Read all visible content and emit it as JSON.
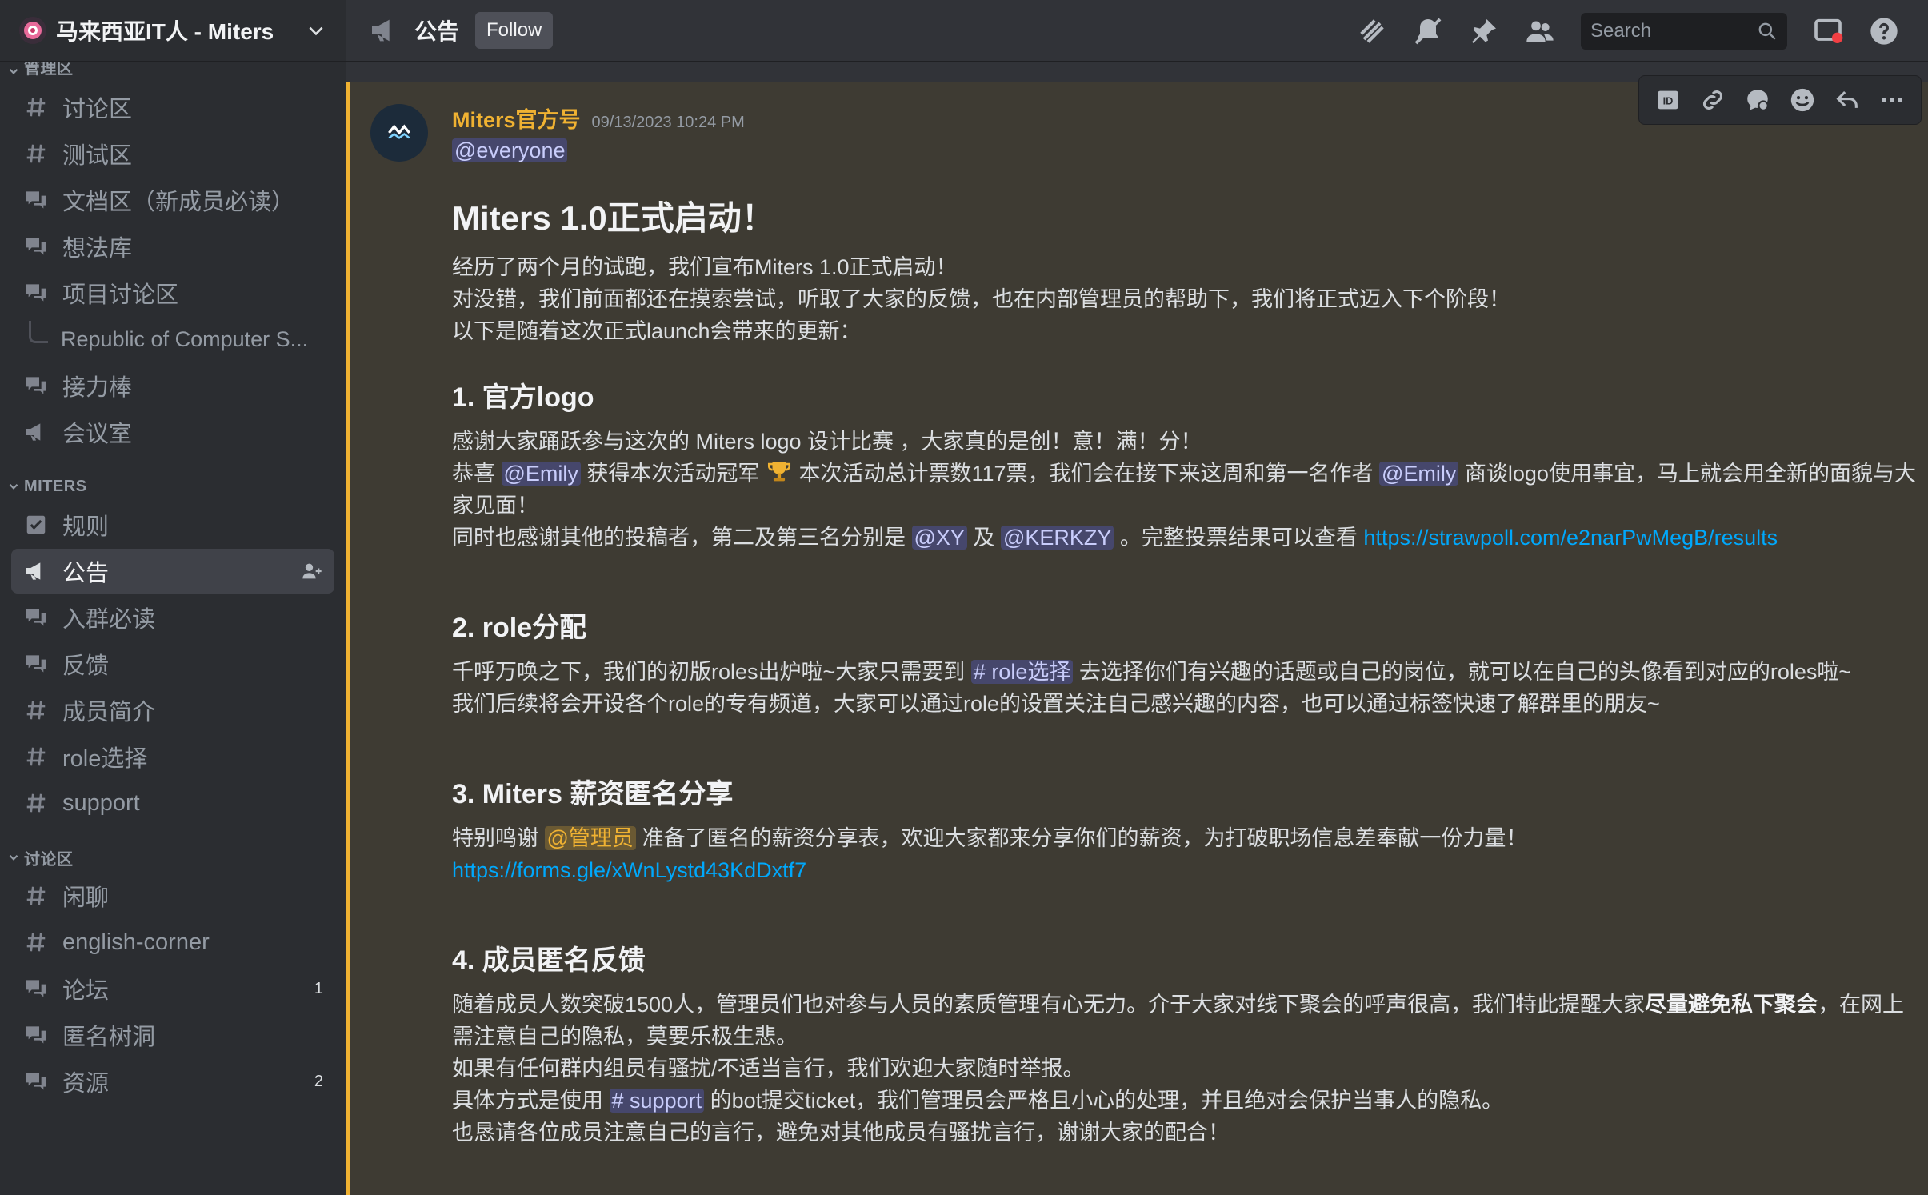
{
  "server": {
    "name": "马来西亚IT人 - Miters"
  },
  "sidebar": {
    "partial_category": "管理区",
    "top_channels": [
      {
        "icon": "hash-icon",
        "label": "讨论区"
      },
      {
        "icon": "hash-icon",
        "label": "测试区"
      },
      {
        "icon": "forum-icon",
        "label": "文档区（新成员必读）"
      },
      {
        "icon": "forum-icon",
        "label": "想法库"
      },
      {
        "icon": "forum-icon",
        "label": "项目讨论区"
      }
    ],
    "thread": {
      "label": "Republic of Computer S..."
    },
    "top_channels_2": [
      {
        "icon": "forum-icon",
        "label": "接力棒"
      },
      {
        "icon": "announce-icon",
        "label": "会议室"
      }
    ],
    "category_miters": "MITERS",
    "miters_channels": [
      {
        "icon": "rules-icon",
        "label": "规则"
      },
      {
        "icon": "announce-icon",
        "label": "公告",
        "active": true
      },
      {
        "icon": "forum-icon",
        "label": "入群必读"
      },
      {
        "icon": "forum-icon",
        "label": "反馈"
      },
      {
        "icon": "hash-icon",
        "label": "成员简介"
      },
      {
        "icon": "hash-icon",
        "label": "role选择"
      },
      {
        "icon": "hash-icon",
        "label": "support"
      }
    ],
    "category_discuss": "讨论区",
    "discuss_channels": [
      {
        "icon": "hash-icon",
        "label": "闲聊"
      },
      {
        "icon": "hash-icon",
        "label": "english-corner"
      },
      {
        "icon": "forum-icon",
        "label": "论坛",
        "badge": "1"
      },
      {
        "icon": "forum-icon",
        "label": "匿名树洞"
      },
      {
        "icon": "forum-icon",
        "label": "资源",
        "badge": "2"
      }
    ]
  },
  "topbar": {
    "channel_name": "公告",
    "follow_label": "Follow",
    "search_placeholder": "Search"
  },
  "message": {
    "author": "Miters官方号",
    "timestamp": "09/13/2023 10:24 PM",
    "mention_everyone": "@everyone",
    "title": "Miters 1.0正式启动！",
    "intro": [
      "经历了两个月的试跑，我们宣布Miters 1.0正式启动！",
      "对没错，我们前面都还在摸索尝试，听取了大家的反馈，也在内部管理员的帮助下，我们将正式迈入下个阶段！",
      "以下是随着这次正式launch会带来的更新："
    ],
    "s1": {
      "heading": "1. 官方logo",
      "line1": "感谢大家踊跃参与这次的 Miters logo 设计比赛 ，大家真的是创！意！满！分！",
      "l2a": "恭喜 ",
      "l2_mention1": "@Emily",
      "l2b": " 获得本次活动冠军 ",
      "l2c": " 本次活动总计票数117票，我们会在接下来这周和第一名作者 ",
      "l2_mention2": "@Emily",
      "l2d": " 商谈logo使用事宜，马上就会用全新的面貌与大家见面！",
      "l3a": "同时也感谢其他的投稿者，第二及第三名分别是 ",
      "l3_mention1": "@XY",
      "l3b": " 及 ",
      "l3_mention2": "@KERKZY",
      "l3c": " 。完整投票结果可以查看 ",
      "l3_link": "https://strawpoll.com/e2narPwMegB/results"
    },
    "s2": {
      "heading": "2. role分配",
      "l1a": "千呼万唤之下，我们的初版roles出炉啦~大家只需要到 ",
      "l1_channel": "# role选择",
      "l1b": " 去选择你们有兴趣的话题或自己的岗位，就可以在自己的头像看到对应的roles啦~",
      "l2": "我们后续将会开设各个role的专有频道，大家可以通过role的设置关注自己感兴趣的内容，也可以通过标签快速了解群里的朋友~"
    },
    "s3": {
      "heading": "3. Miters 薪资匿名分享",
      "l1a": "特别鸣谢 ",
      "l1_mention": "@管理员",
      "l1b": " 准备了匿名的薪资分享表，欢迎大家都来分享你们的薪资，为打破职场信息差奉献一份力量！",
      "link": "https://forms.gle/xWnLystd43KdDxtf7"
    },
    "s4": {
      "heading": "4. 成员匿名反馈",
      "l1a": "随着成员人数突破1500人，管理员们也对参与人员的素质管理有心无力。介于大家对线下聚会的呼声很高，我们特此提醒大家",
      "l1_bold": "尽量避免私下聚会",
      "l1b": "，在网上需注意自己的隐私，莫要乐极生悲。",
      "l2": "如果有任何群内组员有骚扰/不适当言行，我们欢迎大家随时举报。",
      "l3a": "具体方式是使用 ",
      "l3_channel": "# support",
      "l3b": " 的bot提交ticket，我们管理员会严格且小心的处理，并且绝对会保护当事人的隐私。",
      "l4": "也恳请各位成员注意自己的言行，避免对其他成员有骚扰言行，谢谢大家的配合！"
    }
  },
  "colors": {
    "accent": "#f0b232",
    "link": "#00a8fc",
    "mention": "#c9cdfb",
    "sidebar_bg": "#2b2d31",
    "main_bg": "#313338"
  }
}
